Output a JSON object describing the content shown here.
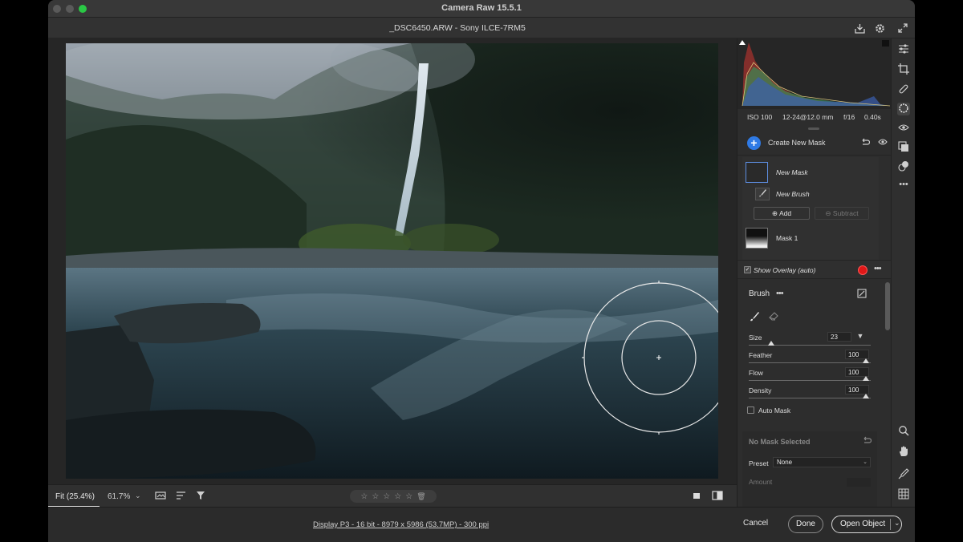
{
  "app": {
    "window_title": "Camera Raw 15.5.1",
    "file_title": "_DSC6450.ARW  -  Sony ILCE-7RM5"
  },
  "photo_toolbar": {
    "zoom_fit": "Fit (25.4%)",
    "zoom_percent": "61.7%"
  },
  "exif": {
    "iso": "ISO 100",
    "lens": "12-24@12.0 mm",
    "aperture": "f/16",
    "shutter": "0.40s"
  },
  "masking": {
    "create_new_mask": "Create New Mask",
    "new_mask": "New Mask",
    "new_brush": "New Brush",
    "add": "Add",
    "subtract": "Subtract",
    "mask1": "Mask 1",
    "show_overlay": "Show Overlay (auto)",
    "overlay_color": "#e01717"
  },
  "brush": {
    "title": "Brush",
    "size_label": "Size",
    "size": "23",
    "feather_label": "Feather",
    "feather": "100",
    "flow_label": "Flow",
    "flow": "100",
    "density_label": "Density",
    "density": "100",
    "auto_mask": "Auto Mask"
  },
  "no_mask": {
    "title": "No Mask Selected",
    "preset_label": "Preset",
    "preset_value": "None",
    "amount_label": "Amount"
  },
  "footer": {
    "info": "Display P3 - 16 bit - 8979 x 5986 (53.7MP) - 300 ppi",
    "cancel": "Cancel",
    "done": "Done",
    "open_object": "Open Object"
  }
}
